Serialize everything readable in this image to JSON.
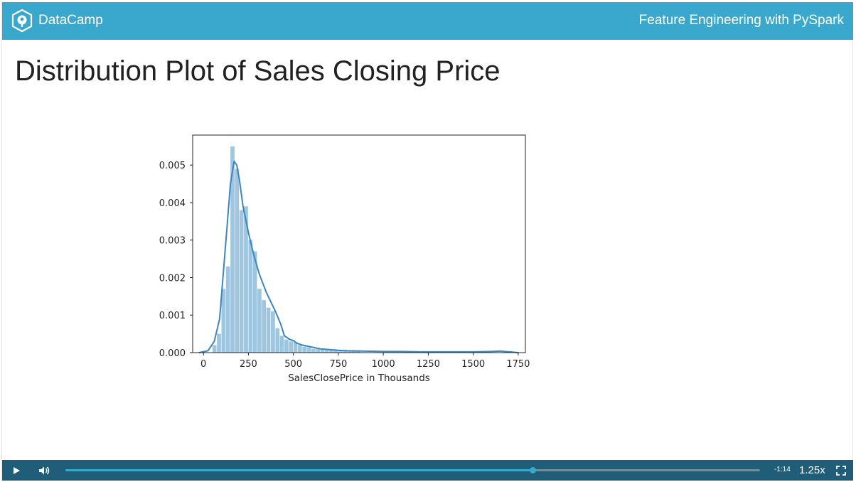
{
  "header": {
    "brand": "DataCamp",
    "brand_icon": "datacamp-logo-icon",
    "course_title": "Feature Engineering with PySpark"
  },
  "slide": {
    "title": "Distribution Plot of Sales Closing Price"
  },
  "chart_data": {
    "type": "histogram with density curve",
    "title": "",
    "xlabel": "SalesClosePrice in Thousands",
    "ylabel": "",
    "xlim": [
      -60,
      1790
    ],
    "ylim": [
      0,
      0.0058
    ],
    "xticks": [
      0,
      250,
      500,
      750,
      1000,
      1250,
      1500,
      1750
    ],
    "yticks": [
      0.0,
      0.001,
      0.002,
      0.003,
      0.004,
      0.005
    ],
    "xtick_labels": [
      "0",
      "250",
      "500",
      "750",
      "1000",
      "1250",
      "1500",
      "1750"
    ],
    "ytick_labels": [
      "0.000",
      "0.001",
      "0.002",
      "0.003",
      "0.004",
      "0.005"
    ],
    "grid": false,
    "colors": {
      "bars": "#9ec6e0",
      "curve": "#3a86bf"
    },
    "bins": {
      "width": 25,
      "x": [
        50,
        75,
        100,
        125,
        150,
        175,
        200,
        225,
        250,
        275,
        300,
        325,
        350,
        375,
        400,
        425,
        450,
        475,
        500,
        525,
        550,
        575,
        600,
        625,
        650,
        675,
        700,
        725,
        750,
        775,
        800,
        825,
        850
      ],
      "density": [
        0.0002,
        0.0005,
        0.0017,
        0.0023,
        0.0055,
        0.0049,
        0.0038,
        0.0039,
        0.003,
        0.0027,
        0.0017,
        0.0014,
        0.0012,
        0.0011,
        0.00065,
        0.00045,
        0.00035,
        0.0003,
        0.00028,
        0.0002,
        0.00016,
        0.00014,
        0.0001,
        0.0001,
        8e-05,
        7e-05,
        6e-05,
        5e-05,
        5e-05,
        4e-05,
        4e-05,
        3e-05,
        3e-05
      ]
    },
    "kde": {
      "x": [
        -25,
        25,
        60,
        90,
        110,
        130,
        150,
        170,
        185,
        200,
        220,
        250,
        280,
        310,
        350,
        400,
        430,
        450,
        480,
        500,
        520,
        550,
        600,
        650,
        700,
        750,
        800,
        900,
        1000,
        1100,
        1200,
        1300,
        1400,
        1500,
        1600,
        1650,
        1700,
        1750
      ],
      "density": [
        0.0,
        5e-05,
        0.0003,
        0.0009,
        0.0021,
        0.0033,
        0.0045,
        0.0051,
        0.005,
        0.0046,
        0.0039,
        0.0032,
        0.0026,
        0.0021,
        0.0016,
        0.0011,
        0.00075,
        0.00045,
        0.00035,
        0.00032,
        0.00025,
        0.0002,
        0.00015,
        0.0001,
        8e-05,
        6e-05,
        5e-05,
        4e-05,
        3e-05,
        3e-05,
        2e-05,
        2e-05,
        2e-05,
        2e-05,
        3e-05,
        4e-05,
        2e-05,
        0.0
      ]
    }
  },
  "player": {
    "play_icon": "play-icon",
    "volume_icon": "volume-icon",
    "fullscreen_icon": "fullscreen-icon",
    "progress_fraction": 0.672,
    "time_remaining": "-1:14",
    "speed": "1.25x"
  }
}
